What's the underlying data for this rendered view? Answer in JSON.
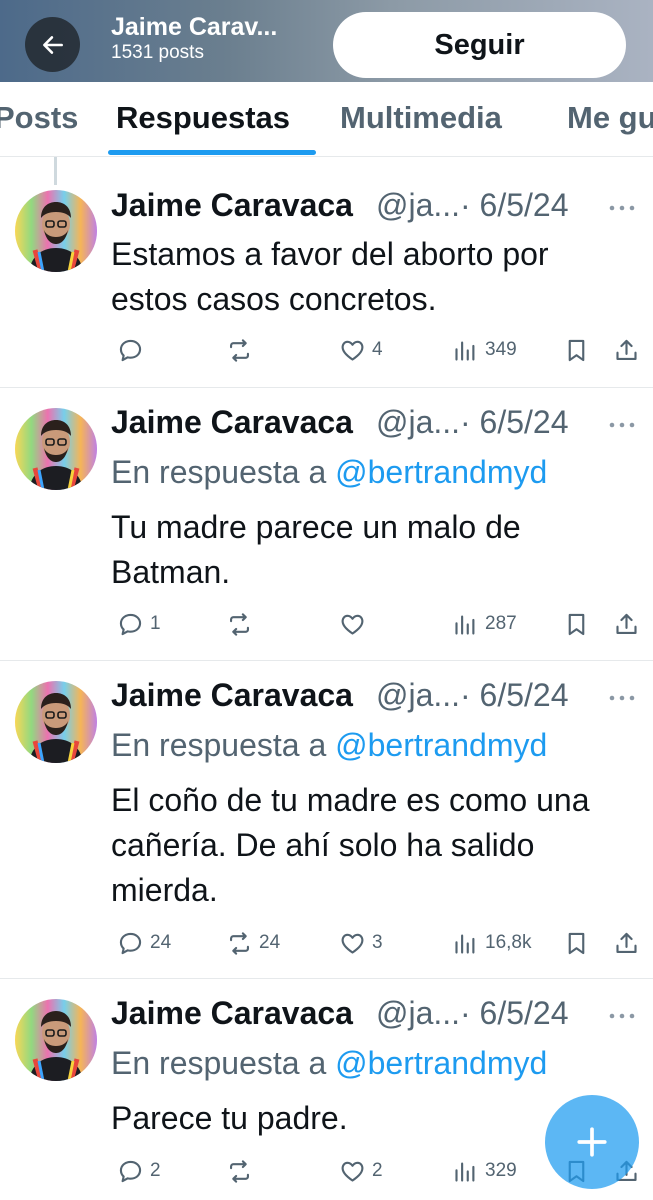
{
  "header": {
    "name": "Jaime Carav...",
    "post_count": "1531 posts",
    "follow_label": "Seguir"
  },
  "tabs": [
    {
      "label": "Posts"
    },
    {
      "label": "Respuestas"
    },
    {
      "label": "Multimedia"
    },
    {
      "label": "Me gu"
    }
  ],
  "active_tab": "Respuestas",
  "posts": [
    {
      "name": "Jaime Caravaca",
      "handle": "@ja...",
      "date": "· 6/5/24",
      "reply_prefix": "",
      "reply_handle": "",
      "text": "Estamos a favor del aborto por estos casos concretos.",
      "replies": "",
      "reposts": "",
      "likes": "4",
      "views": "349"
    },
    {
      "name": "Jaime Caravaca",
      "handle": "@ja...",
      "date": "· 6/5/24",
      "reply_prefix": "En respuesta a ",
      "reply_handle": "@bertrandmyd",
      "text": "Tu madre parece un malo de Batman.",
      "replies": "1",
      "reposts": "",
      "likes": "",
      "views": "287"
    },
    {
      "name": "Jaime Caravaca",
      "handle": "@ja...",
      "date": "· 6/5/24",
      "reply_prefix": "En respuesta a ",
      "reply_handle": "@bertrandmyd",
      "text": "El coño de tu madre es como una cañería. De ahí solo ha salido mierda.",
      "replies": "24",
      "reposts": "24",
      "likes": "3",
      "views": "16,8k"
    },
    {
      "name": "Jaime Caravaca",
      "handle": "@ja...",
      "date": "· 6/5/24",
      "reply_prefix": "En respuesta a ",
      "reply_handle": "@bertrandmyd",
      "text": "Parece tu padre.",
      "replies": "2",
      "reposts": "",
      "likes": "2",
      "views": "329"
    }
  ],
  "colors": {
    "accent": "#1d9bf0",
    "secondary_text": "#536471",
    "primary_text": "#0f1419"
  },
  "icons": [
    "back-arrow-icon",
    "more-icon",
    "reply-icon",
    "repost-icon",
    "like-icon",
    "views-icon",
    "bookmark-icon",
    "share-icon",
    "compose-plus-icon"
  ]
}
